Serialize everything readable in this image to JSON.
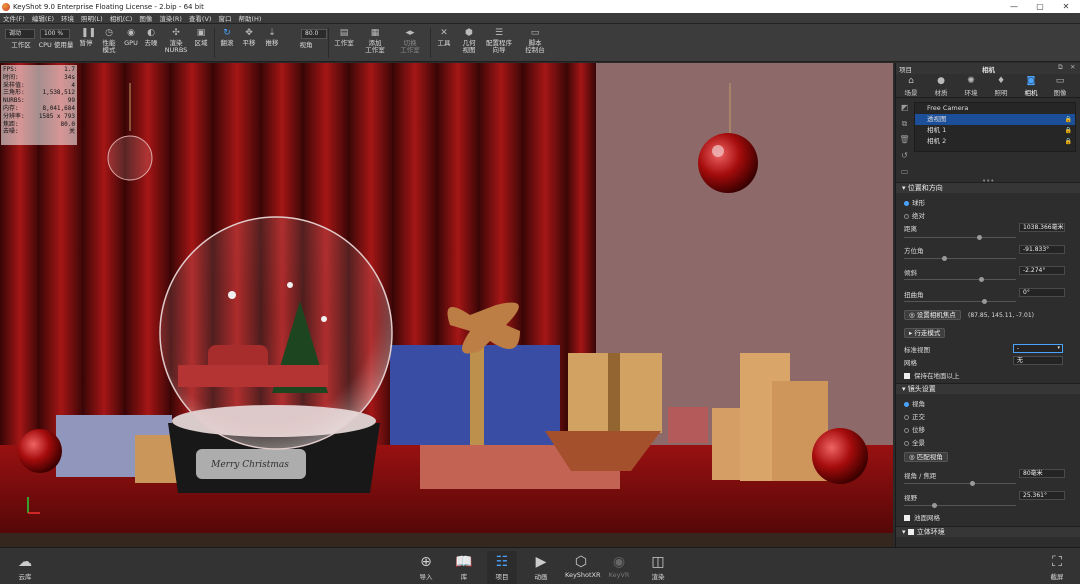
{
  "titlebar": {
    "title": "KeyShot 9.0 Enterprise Floating License  -  2.bip  -  64 bit",
    "min": "—",
    "max": "▢",
    "close": "✕"
  },
  "menu": [
    "文件(F)",
    "编辑(E)",
    "环境",
    "照明(L)",
    "相机(C)",
    "图像",
    "渲染(R)",
    "查看(V)",
    "窗口",
    "帮助(H)"
  ],
  "toolbar": {
    "preset_select": "调动",
    "workspace": "工作区",
    "cpu_select": "100 %",
    "cpu_usage": "CPU 使用量",
    "pause": "暂停",
    "perf_mode": "性能\n模式",
    "gpu": "GPU",
    "denoise": "去噪",
    "render_nurbs": "渲染\nNURBS",
    "region": "区域",
    "tumble": "翻滚",
    "pan": "平移",
    "dolly": "推移",
    "fov_value": "80.0",
    "fov": "视角",
    "studio": "工作室",
    "add_studio": "添加\n工作室",
    "switch_studio": "切换\n工作室",
    "tools": "工具",
    "geometry_view": "几何\n视图",
    "configurator_wizard": "配置程序\n向导",
    "script_console": "脚本\n控制台"
  },
  "stats": [
    {
      "k": "FPS:",
      "v": "1.7"
    },
    {
      "k": "时间:",
      "v": "34s"
    },
    {
      "k": "采样值:",
      "v": "4"
    },
    {
      "k": "三角形:",
      "v": "1,538,512"
    },
    {
      "k": "NURBS:",
      "v": "99"
    },
    {
      "k": "内存:",
      "v": "8,041,684"
    },
    {
      "k": "分辨率:",
      "v": "1585 x 793"
    },
    {
      "k": "焦距:",
      "v": "80.0"
    },
    {
      "k": "去噪:",
      "v": "关"
    }
  ],
  "scene": {
    "nameplate": "Merry Christmas"
  },
  "panel": {
    "left_header": "项目",
    "header": "相机",
    "tabs": [
      {
        "label": "场景",
        "icon": "scene-icon"
      },
      {
        "label": "材质",
        "icon": "material-icon"
      },
      {
        "label": "环境",
        "icon": "environment-icon"
      },
      {
        "label": "照明",
        "icon": "lighting-icon"
      },
      {
        "label": "相机",
        "icon": "camera-icon"
      },
      {
        "label": "图像",
        "icon": "image-icon"
      }
    ],
    "cameras": [
      {
        "name": "Free Camera",
        "selected": false,
        "locked": false
      },
      {
        "name": "透视图",
        "selected": true,
        "locked": true
      },
      {
        "name": "相机 1",
        "selected": false,
        "locked": true
      },
      {
        "name": "相机 2",
        "selected": false,
        "locked": true
      }
    ],
    "pos_section": "位置和方向",
    "mode_orbit": "球形",
    "mode_absolute": "绝对",
    "distance_label": "距离",
    "distance_value": "1038.366毫米",
    "azimuth_label": "方位角",
    "azimuth_value": "-91.833°",
    "incline_label": "倾斜",
    "incline_value": "-2.274°",
    "twist_label": "扭曲角",
    "twist_value": "0°",
    "set_pivot_btn": "设置相机焦点",
    "pivot_coords": "(87.85, 145.11, -7.01)",
    "walk_mode_btn": "行走模式",
    "std_view_label": "标准视图",
    "std_view_value": "-",
    "grid_label": "网格",
    "grid_value": "无",
    "keep_above_ground": "保持在地面以上",
    "lens_section": "镜头设置",
    "lens_fov": "视角",
    "lens_orthographic": "正交",
    "lens_shift": "位移",
    "lens_panoramic": "全景",
    "match_fov_btn": "匹配视角",
    "fov_focal_label": "视角 / 焦距",
    "fov_focal_value": "80毫米",
    "fov_label": "视野",
    "fov_value": "25.361°",
    "guide_grid": "池面网格",
    "stereo_section": "立体环境"
  },
  "bottombar": [
    {
      "label": "云库",
      "icon": "cloud-library-icon",
      "active": false,
      "dim": false
    },
    {
      "label": "导入",
      "icon": "import-icon",
      "active": false,
      "dim": false
    },
    {
      "label": "库",
      "icon": "library-icon",
      "active": false,
      "dim": false
    },
    {
      "label": "项目",
      "icon": "project-icon",
      "active": true,
      "dim": false
    },
    {
      "label": "动画",
      "icon": "animation-icon",
      "active": false,
      "dim": false
    },
    {
      "label": "KeyShotXR",
      "icon": "keyshotxr-icon",
      "active": false,
      "dim": false
    },
    {
      "label": "KeyVR",
      "icon": "keyvr-icon",
      "active": false,
      "dim": true
    },
    {
      "label": "渲染",
      "icon": "render-icon",
      "active": false,
      "dim": false
    },
    {
      "label": "截屏",
      "icon": "screenshot-icon",
      "active": false,
      "dim": false
    }
  ],
  "colors": {
    "accent": "#4aa3ff",
    "selected_row": "#1c4f9a",
    "viewport_bg": "#6a1414"
  }
}
